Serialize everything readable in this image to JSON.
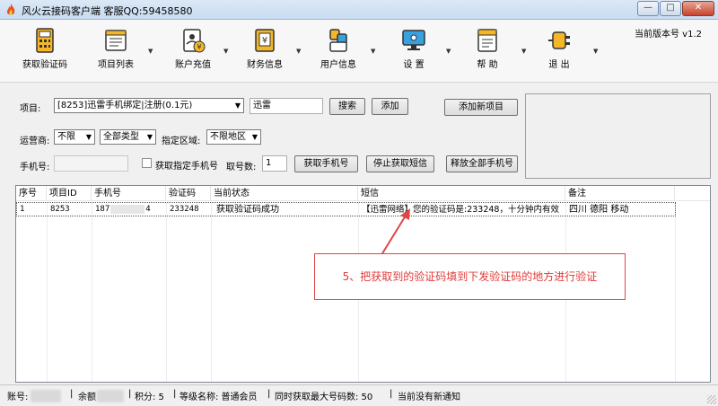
{
  "window": {
    "title": "风火云接码客户端  客服QQ:59458580",
    "minimize": "—",
    "maximize": "□",
    "close": "✕"
  },
  "toolbar": {
    "items": [
      {
        "label": "获取验证码",
        "icon": "calculator-icon"
      },
      {
        "label": "项目列表",
        "icon": "list-icon"
      },
      {
        "label": "账户充值",
        "icon": "recharge-icon"
      },
      {
        "label": "财务信息",
        "icon": "finance-icon"
      },
      {
        "label": "用户信息",
        "icon": "user-icon"
      },
      {
        "label": "设  置",
        "icon": "monitor-settings-icon"
      },
      {
        "label": "帮  助",
        "icon": "help-doc-icon"
      },
      {
        "label": "退  出",
        "icon": "exit-plug-icon"
      }
    ],
    "version": "当前版本号 v1.2"
  },
  "form": {
    "project_label": "项目:",
    "project_value": "[8253]迅雷手机绑定|注册(0.1元)",
    "keyword_value": "迅雷",
    "search_btn": "搜索",
    "add_btn": "添加",
    "add_new_btn": "添加新项目",
    "carrier_label": "运营商:",
    "carrier_value": "不限",
    "type_value": "全部类型",
    "region_label": "指定区域:",
    "region_value": "不限地区",
    "phone_label": "手机号:",
    "phone_value": "",
    "specific_phone_label": "获取指定手机号",
    "count_label": "取号数:",
    "count_value": "1",
    "get_phone_btn": "获取手机号",
    "stop_sms_btn": "停止获取短信",
    "release_all_btn": "释放全部手机号"
  },
  "table": {
    "columns": [
      "序号",
      "项目ID",
      "手机号",
      "验证码",
      "当前状态",
      "短信",
      "备注"
    ],
    "rows": [
      {
        "seq": "1",
        "project_id": "8253",
        "phone_start": "187",
        "phone_end": "4",
        "code": "233248",
        "status": "获取验证码成功",
        "sms": "【迅雷网络】您的验证码是:233248，十分钟内有效",
        "note": "四川 德阳 移动"
      }
    ]
  },
  "annotation": {
    "text": "5、把获取到的验证码填到下发验证码的地方进行验证",
    "color": "#e04646"
  },
  "status": {
    "account_label": "账号:",
    "balance_label": "余额",
    "points": "积分: 5",
    "level": "等级名称: 普通会员",
    "max_numbers": "同时获取最大号码数: 50",
    "notice": "当前没有新通知"
  }
}
